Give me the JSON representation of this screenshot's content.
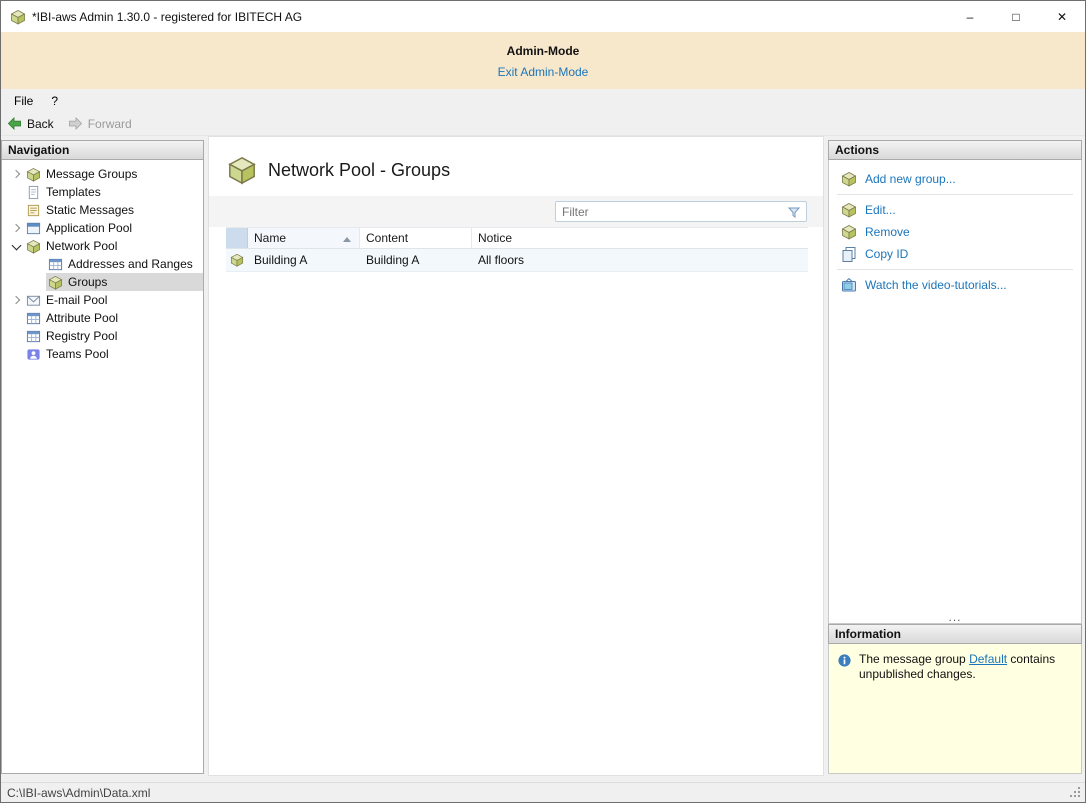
{
  "window": {
    "title": "*IBI-aws Admin 1.30.0 - registered for IBITECH AG",
    "minimize_glyph": "–",
    "maximize_glyph": "□",
    "close_glyph": "✕"
  },
  "admin_banner": {
    "title": "Admin-Mode",
    "exit_link": "Exit Admin-Mode"
  },
  "menu": {
    "file": "File",
    "help": "?"
  },
  "toolbar": {
    "back_label": "Back",
    "forward_label": "Forward"
  },
  "navigation": {
    "header": "Navigation",
    "items": [
      {
        "label": "Message Groups",
        "icon": "message-groups-icon",
        "expander": "collapsed",
        "indent": 0,
        "selected": false
      },
      {
        "label": "Templates",
        "icon": "templates-icon",
        "expander": "none",
        "indent": 0,
        "selected": false
      },
      {
        "label": "Static Messages",
        "icon": "static-messages-icon",
        "expander": "none",
        "indent": 0,
        "selected": false
      },
      {
        "label": "Application Pool",
        "icon": "application-pool-icon",
        "expander": "collapsed",
        "indent": 0,
        "selected": false
      },
      {
        "label": "Network Pool",
        "icon": "network-pool-icon",
        "expander": "expanded",
        "indent": 0,
        "selected": false
      },
      {
        "label": "Addresses and Ranges",
        "icon": "addresses-and-ranges-icon",
        "expander": "none",
        "indent": 1,
        "selected": false
      },
      {
        "label": "Groups",
        "icon": "groups-icon",
        "expander": "none",
        "indent": 1,
        "selected": true
      },
      {
        "label": "E-mail Pool",
        "icon": "email-pool-icon",
        "expander": "collapsed",
        "indent": 0,
        "selected": false
      },
      {
        "label": "Attribute Pool",
        "icon": "attribute-pool-icon",
        "expander": "none",
        "indent": 0,
        "selected": false
      },
      {
        "label": "Registry Pool",
        "icon": "registry-pool-icon",
        "expander": "none",
        "indent": 0,
        "selected": false
      },
      {
        "label": "Teams Pool",
        "icon": "teams-pool-icon",
        "expander": "none",
        "indent": 0,
        "selected": false
      }
    ]
  },
  "main": {
    "title": "Network Pool - Groups",
    "filter_placeholder": "Filter",
    "table": {
      "columns": [
        "Name",
        "Content",
        "Notice"
      ],
      "sorted_column": "Name",
      "sort_direction": "ascending",
      "rows": [
        {
          "name": "Building A",
          "content": "Building A",
          "notice": "All floors"
        }
      ]
    }
  },
  "actions": {
    "header": "Actions",
    "items": [
      {
        "label": "Add new group...",
        "icon": "add-group-icon"
      },
      {
        "label": "Edit...",
        "icon": "edit-group-icon"
      },
      {
        "label": "Remove",
        "icon": "remove-group-icon"
      },
      {
        "label": "Copy ID",
        "icon": "copy-id-icon"
      },
      {
        "label": "Watch the video-tutorials...",
        "icon": "video-tutorials-icon"
      }
    ],
    "overflow": "..."
  },
  "information": {
    "header": "Information",
    "text_before": "The message group ",
    "link_text": "Default",
    "text_after": " contains unpublished changes."
  },
  "status_bar": {
    "path": "C:\\IBI-aws\\Admin\\Data.xml"
  },
  "colors": {
    "link": "#1b75bb",
    "banner_bg": "#f7e8cc",
    "info_bg": "#ffffe1",
    "selection_bg": "#d9d9d9",
    "header_gradient_top": "#f3f3f3",
    "header_gradient_bottom": "#d9d9d9"
  }
}
